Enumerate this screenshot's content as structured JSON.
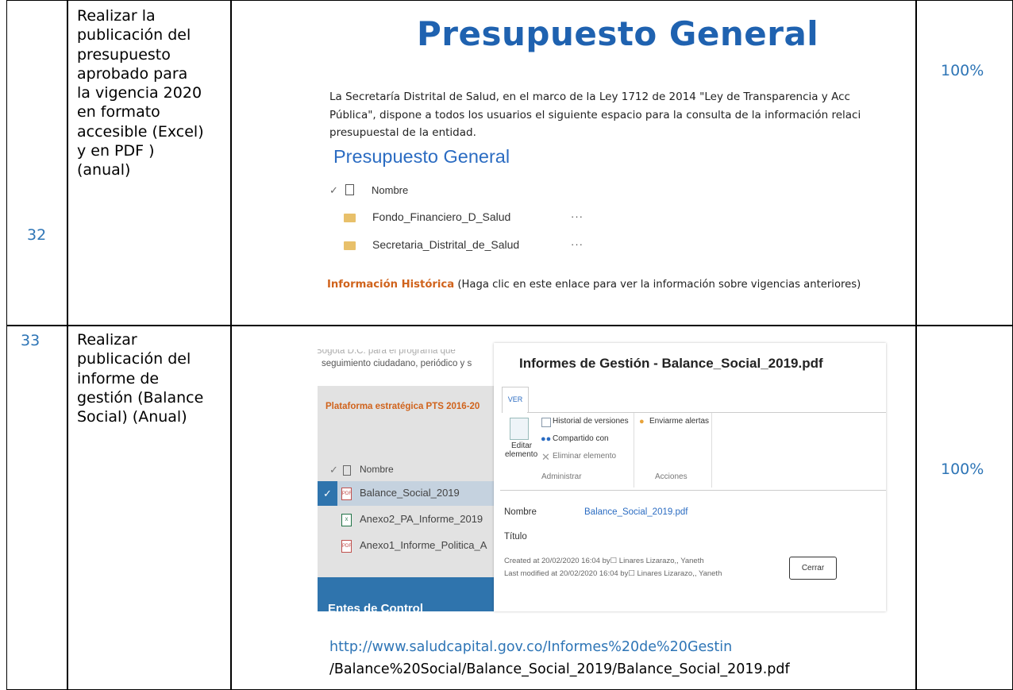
{
  "rows": [
    {
      "num": "32",
      "desc_lines": [
        "Realizar la",
        "publicación del",
        "presupuesto",
        "aprobado para",
        "la vigencia 2020",
        "en  formato",
        "accesible (Excel)",
        "y en PDF )",
        "(anual)"
      ],
      "pct": "100%"
    },
    {
      "num": "33",
      "desc_lines": [
        "Realizar",
        "publicación del",
        "informe de",
        "gestión (Balance",
        "Social) (Anual)"
      ],
      "pct": "100%"
    }
  ],
  "shot1": {
    "title": "Presupuesto General",
    "para_lines": [
      "La Secretaría Distrital de Salud, en el marco de la Ley 1712 de 2014 \"Ley de Transparencia y Acc",
      "Pública\", dispone a todos los usuarios el siguiente espacio para la consulta de la información relaci",
      "presupuestal de la entidad."
    ],
    "subtitle": "Presupuesto General",
    "col_header": "Nombre",
    "folders": [
      "Fondo_Financiero_D_Salud",
      "Secretaria_Distrital_de_Salud"
    ],
    "dots": "···",
    "hist_link": "Información Histórica",
    "hist_text": " (Haga clic en este enlace para ver la información sobre vigencias anteriores)"
  },
  "shot2": {
    "bg_line1": "Bogotá D.C. para el programa que",
    "bg_line2": "seguimiento ciudadano, periódico y s",
    "plataforma": "Plataforma estratégica PTS 2016-20",
    "col_header": "Nombre",
    "files": [
      "Balance_Social_2019",
      "Anexo2_PA_Informe_2019",
      "Anexo1_Informe_Politica_A"
    ],
    "file_icons": [
      "pdf-icon",
      "excel-icon",
      "pdf-icon"
    ],
    "entes": "Entes de Control",
    "dialog": {
      "title": "Informes de Gestión - Balance_Social_2019.pdf",
      "tab": "VER",
      "edit_line1": "Editar",
      "edit_line2": "elemento",
      "historial": "Historial de versiones",
      "compartido": "Compartido con",
      "eliminar": "Eliminar elemento",
      "alertas": "Enviarme alertas",
      "group_admin": "Administrar",
      "group_acciones": "Acciones",
      "nombre_label": "Nombre",
      "nombre_value": "Balance_Social_2019.pdf",
      "titulo_label": "Título",
      "created": "Created at 20/02/2020 16:04  by☐ Linares Lizarazo,, Yaneth",
      "modified": "Last modified at 20/02/2020 16:04  by☐ Linares Lizarazo,, Yaneth",
      "close": "Cerrar"
    }
  },
  "url_line1": "http://www.saludcapital.gov.co/Informes%20de%20Gestin",
  "url_line2": "/Balance%20Social/Balance_Social_2019/Balance_Social_2019.pdf"
}
